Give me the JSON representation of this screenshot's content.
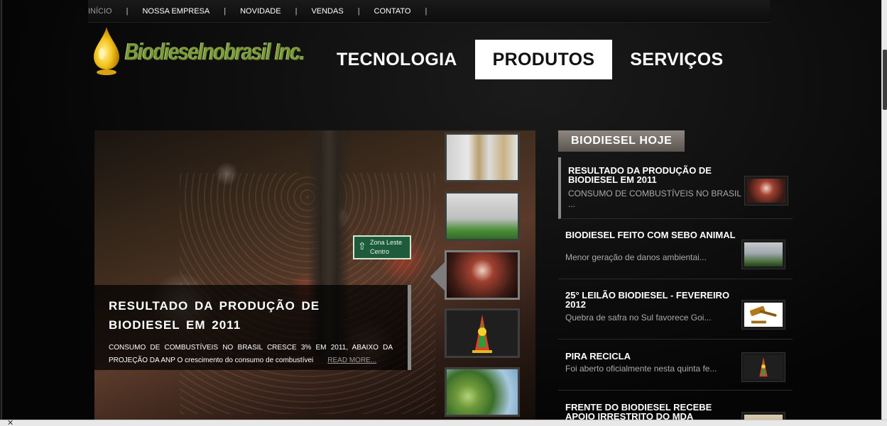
{
  "topnav": {
    "items": [
      "INÍCIO",
      "NOSSA EMPRESA",
      "NOVIDADE",
      "VENDAS",
      "CONTATO"
    ],
    "separator": "|"
  },
  "logo": {
    "brand": "Biodieselnobrasil Inc."
  },
  "mainnav": {
    "items": [
      "TECNOLOGIA",
      "PRODUTOS",
      "SERVIÇOS"
    ],
    "active_index": 1
  },
  "slider": {
    "sign_line1": "Zona Leste",
    "sign_line2": "Centro",
    "sign_arrow": "⇧",
    "caption": {
      "title": "RESULTADO DA PRODUÇÃO DE BIODIESEL EM 2011",
      "text": "CONSUMO DE COMBUSTÍVEIS NO BRASIL CRESCE  3% EM 2011, ABAIXO DA PROJEÇÃO DA ANP O crescimento do consumo de combustívei",
      "more": "READ MORE..."
    },
    "thumbs": [
      "processor-thumb",
      "factory-thumb",
      "traffic-thumb",
      "recycle-logo-thumb",
      "fruit-thumb"
    ],
    "active_thumb": 2
  },
  "side": {
    "title": "BIODIESEL HOJE",
    "news": [
      {
        "title": "RESULTADO DA PRODUÇÃO DE BIODIESEL EM 2011",
        "summary": "CONSUMO DE COMBUSTÍVEIS NO BRASIL ..."
      },
      {
        "title": "BIODIESEL FEITO COM SEBO ANIMAL",
        "summary": "Menor geração de danos ambientai..."
      },
      {
        "title": "25° LEILÃO BIODIESEL - FEVEREIRO 2012",
        "summary": "Quebra de safra no Sul favorece Goi..."
      },
      {
        "title": "PIRA RECICLA",
        "summary": "Foi aberto oficialmente nesta quinta fe..."
      },
      {
        "title": "FRENTE DO BIODIESEL RECEBE APOIO IRRESTRITO DO MDA",
        "summary": ""
      }
    ]
  },
  "statusbar": {
    "close_glyph": "✕"
  }
}
